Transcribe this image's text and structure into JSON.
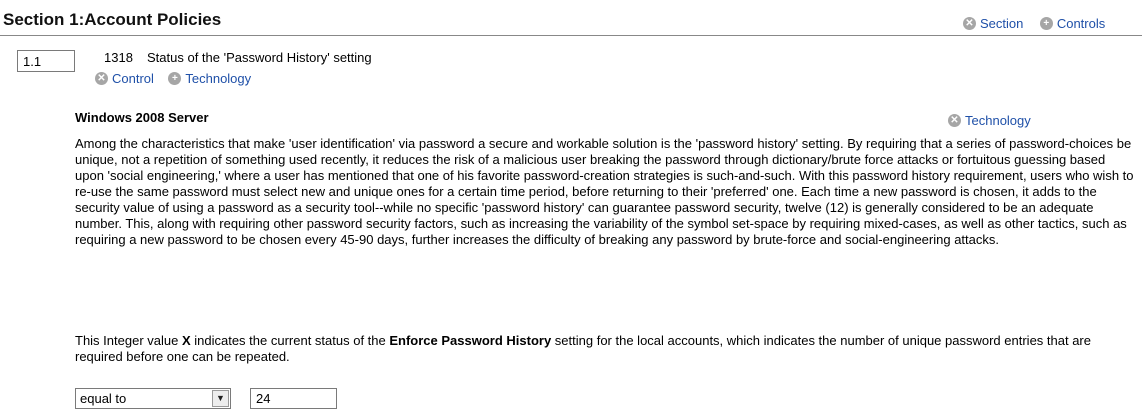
{
  "section": {
    "title": "Section 1:Account Policies",
    "toggle_section": "Section",
    "toggle_controls": "Controls"
  },
  "control": {
    "id_value": "1.1",
    "number": "1318",
    "title": "Status of the 'Password History' setting",
    "toggle_control": "Control",
    "toggle_technology": "Technology"
  },
  "technology": {
    "name": "Windows 2008 Server",
    "toggle_technology": "Technology"
  },
  "description": {
    "paragraph": "Among the characteristics that make 'user identification' via password a secure and workable solution is the 'password history' setting. By requiring that a series of password-choices be unique, not a repetition of something used recently, it reduces the risk of a malicious user breaking the password through dictionary/brute force attacks or fortuitous guessing based upon 'social engineering,' where a user has mentioned that one of his favorite password-creation strategies is such-and-such. With this password history requirement, users who wish to re-use the same password must select new and unique ones for a certain time period, before returning to their 'preferred' one. Each time a new password is chosen, it adds to the security value of using a password as a security tool--while no specific 'password history' can guarantee password security, twelve (12) is generally considered to be an adequate number. This, along with requiring other password security factors, such as increasing the variability of the symbol set-space by requiring mixed-cases, as well as other tactics, such as requiring a new password to be chosen every 45-90 days, further increases the difficulty of breaking any password by brute-force and social-engineering attacks.",
    "value_intro": "This Integer value ",
    "value_var": "X",
    "value_mid": " indicates the current status of the ",
    "value_setting": "Enforce Password History",
    "value_end": " setting for the local accounts, which indicates the number of unique password entries that are required before one can be repeated."
  },
  "condition": {
    "operator": "equal to",
    "value": "24"
  },
  "icons": {
    "collapse": "minus-circle-icon",
    "expand": "plus-circle-icon",
    "dropdown": "dropdown-arrow-icon"
  }
}
